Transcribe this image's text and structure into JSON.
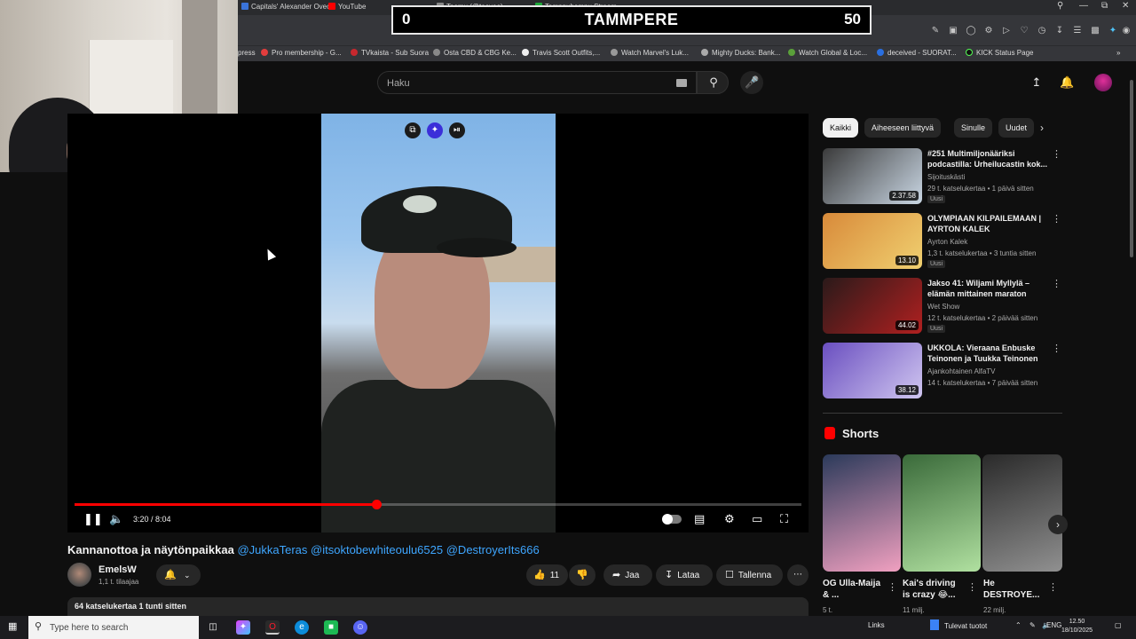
{
  "browser": {
    "tabs": [
      {
        "label": "Capitals' Alexander Ovech",
        "color": "#3a73d9"
      },
      {
        "label": "YouTube",
        "color": "#ff0000"
      },
      {
        "label": "Teemu (@teevee)",
        "color": "#888888"
      },
      {
        "label": "Tamppuhompu Stream",
        "color": "#1fa83a"
      }
    ],
    "bookmarks": [
      {
        "label": "press",
        "color": "#777777"
      },
      {
        "label": "Pro membership - G...",
        "color": "#e33d3d"
      },
      {
        "label": "TVkaista - Sub Suora",
        "color": "#c7282e"
      },
      {
        "label": "Osta CBD & CBG Ke...",
        "color": "#888888"
      },
      {
        "label": "Travis Scott Outfits,...",
        "color": "#eeeeee"
      },
      {
        "label": "Watch Marvel's Luk...",
        "color": "#999999"
      },
      {
        "label": "Mighty Ducks: Bank...",
        "color": "#aaaaaa"
      },
      {
        "label": "Watch Global & Loc...",
        "color": "#5aa03a"
      },
      {
        "label": "deceived - SUORAT...",
        "color": "#2a6fe0"
      },
      {
        "label": "KICK Status Page",
        "color": "#222222"
      }
    ]
  },
  "score_overlay": {
    "left_score": "0",
    "title": "TAMMPERE",
    "right_score": "50"
  },
  "youtube": {
    "search_placeholder": "Haku",
    "player": {
      "timecode": "3:20 / 8:04",
      "progress": 0.415
    },
    "video_title": "Kannanottoa ja näytönpaikkaa",
    "video_tags": [
      "@JukkaTeras",
      "@itsoktobewhiteoulu6525",
      "@DestroyerIts666"
    ],
    "channel": {
      "name": "EmelsW",
      "subscribers": "1,1 t. tilaajaa"
    },
    "actions": {
      "likes": "11",
      "share": "Jaa",
      "download": "Lataa",
      "save": "Tallenna"
    },
    "description_meta": "64 katselukertaa  1 tunti sitten",
    "chips": [
      "Kaikki",
      "Aiheeseen liittyvä",
      "Sinulle",
      "Uudet"
    ],
    "recommendations": [
      {
        "title": "#251 Multimiljonääriksi podcastilla: Urheilucastin kok...",
        "channel": "Sijoituskästi",
        "meta": "29 t. katselukertaa • 1 päivä sitten",
        "badge": "Uusi",
        "duration": "2.37.58",
        "thumb": [
          "#3a3a3a",
          "#c9d6e3"
        ]
      },
      {
        "title": "OLYMPIAAN KILPAILEMAAN | AYRTON KALEK",
        "channel": "Ayrton Kalek",
        "meta": "1,3 t. katselukertaa • 3 tuntia sitten",
        "badge": "Uusi",
        "duration": "13.10",
        "thumb": [
          "#d88a3a",
          "#f0d070"
        ]
      },
      {
        "title": "Jakso 41: Wiljami Myllylä – elämän mittainen maraton",
        "channel": "Wet Show",
        "meta": "12 t. katselukertaa • 2 päivää sitten",
        "badge": "Uusi",
        "duration": "44.02",
        "thumb": [
          "#2a1a1a",
          "#b02020"
        ]
      },
      {
        "title": "UKKOLA: Vieraana Enbuske Teinonen ja Tuukka Teinonen",
        "channel": "Ajankohtainen AlfaTV",
        "meta": "14 t. katselukertaa • 7 päivää sitten",
        "badge": "",
        "duration": "38.12",
        "thumb": [
          "#6a4fc0",
          "#d0c6f0"
        ]
      }
    ],
    "shorts_title": "Shorts",
    "shorts": [
      {
        "title": "OG Ulla-Maija & ...",
        "views": "5 t.",
        "colors": [
          "#2b3a5a",
          "#f0a0c0"
        ]
      },
      {
        "title": "Kai's driving is crazy 😂...",
        "views": "11 milj.",
        "colors": [
          "#3a6a3a",
          "#b0e0a0"
        ]
      },
      {
        "title": "He DESTROYE...",
        "views": "22 milj.",
        "colors": [
          "#2a2a2a",
          "#909090"
        ]
      }
    ]
  },
  "taskbar": {
    "search_placeholder": "Type here to search",
    "links_label": "Links",
    "news_label": "Tulevat tuotot",
    "lang": "ENG",
    "time": "12.50",
    "date": "18/10/2025"
  }
}
